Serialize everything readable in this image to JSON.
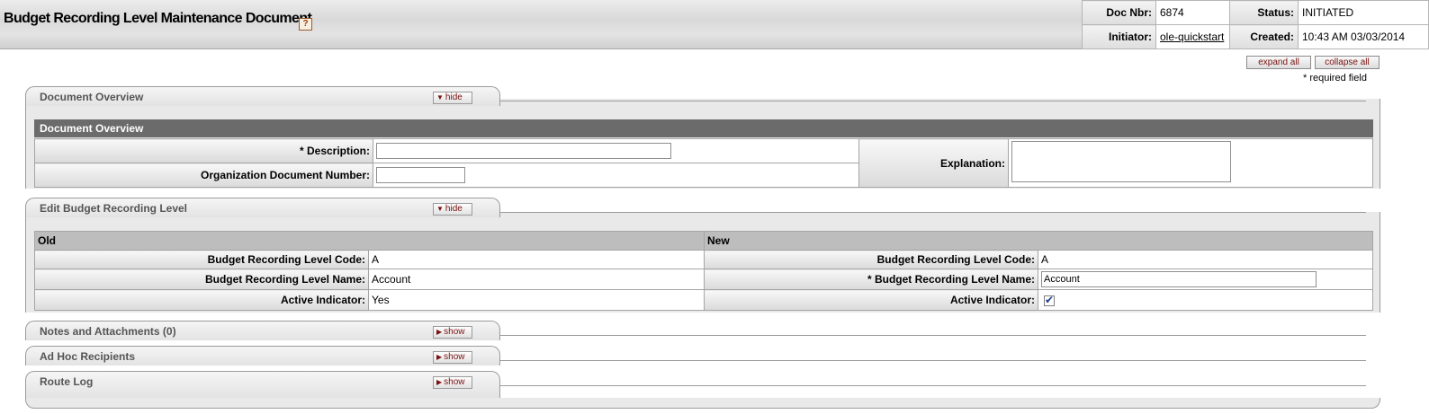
{
  "header": {
    "title": "Budget Recording Level Maintenance Document",
    "help": "?",
    "doc_nbr_label": "Doc Nbr:",
    "doc_nbr": "6874",
    "status_label": "Status:",
    "status": "INITIATED",
    "initiator_label": "Initiator:",
    "initiator": "ole-quickstart",
    "created_label": "Created:",
    "created": "10:43 AM 03/03/2014"
  },
  "controls": {
    "expand_all": "expand all",
    "collapse_all": "collapse all",
    "required_note": "* required field"
  },
  "tabs": {
    "overview": {
      "label": "Document Overview",
      "button": "hide"
    },
    "edit": {
      "label": "Edit Budget Recording Level",
      "button": "hide"
    },
    "notes": {
      "label": "Notes and Attachments (0)",
      "button": "show"
    },
    "adhoc": {
      "label": "Ad Hoc Recipients",
      "button": "show"
    },
    "routelog": {
      "label": "Route Log",
      "button": "show"
    }
  },
  "overview": {
    "header": "Document Overview",
    "description_label": "* Description:",
    "description_value": "",
    "org_doc_label": "Organization Document Number:",
    "org_doc_value": "",
    "explanation_label": "Explanation:",
    "explanation_value": ""
  },
  "edit": {
    "old_header": "Old",
    "new_header": "New",
    "code_label": "Budget Recording Level Code:",
    "name_label": "Budget Recording Level Name:",
    "name_label_required": "* Budget Recording Level Name:",
    "active_label": "Active Indicator:",
    "old_code": "A",
    "old_name": "Account",
    "old_active": "Yes",
    "new_code": "A",
    "new_name": "Account",
    "new_active": true
  },
  "colors": {
    "accent_red": "#7a1010",
    "header_dark": "#6b6b6b"
  }
}
